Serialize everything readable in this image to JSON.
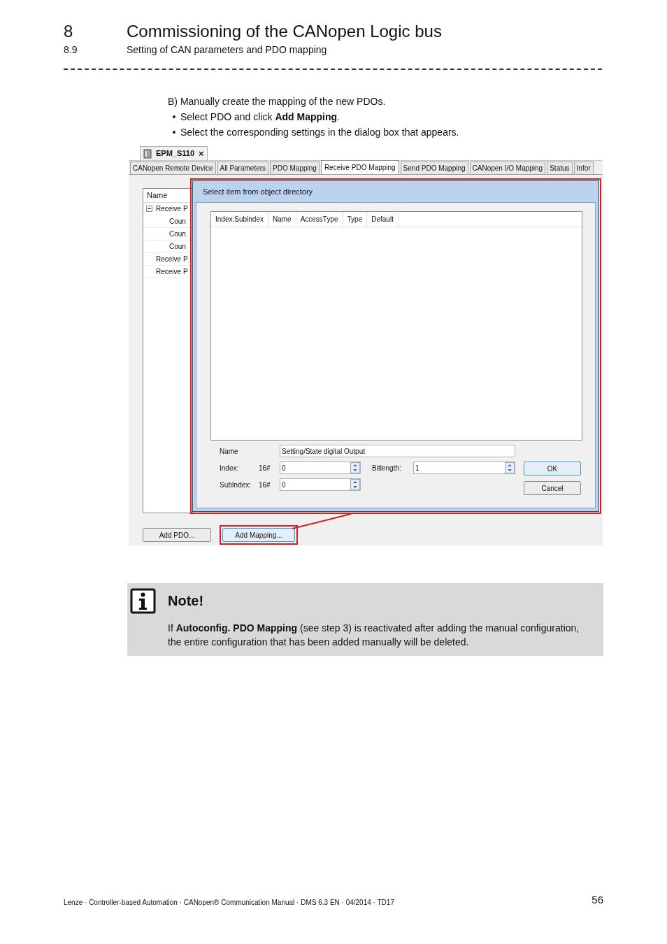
{
  "header": {
    "chapter_number": "8",
    "chapter_title": "Commissioning of the CANopen Logic bus",
    "section_number": "8.9",
    "section_title": "Setting of CAN parameters and PDO mapping"
  },
  "instructions": {
    "heading": "B) Manually create the mapping of the new PDOs.",
    "bullets": [
      {
        "mark": "•",
        "text": "Select PDO and click **Add Mapping**."
      },
      {
        "mark": "•",
        "text": "Select the corresponding settings in the dialog box that appears."
      }
    ]
  },
  "screenshot": {
    "document_tab": {
      "title": "EPM_S110",
      "close": "×"
    },
    "tabs": [
      {
        "label": "CANopen Remote Device",
        "selected": false
      },
      {
        "label": "All Parameters",
        "selected": false
      },
      {
        "label": "PDO Mapping",
        "selected": false
      },
      {
        "label": "Receive PDO Mapping",
        "selected": true
      },
      {
        "label": "Send PDO Mapping",
        "selected": false
      },
      {
        "label": "CANopen I/O Mapping",
        "selected": false
      },
      {
        "label": "Status",
        "selected": false
      },
      {
        "label": "Infor",
        "selected": false
      }
    ],
    "tree": {
      "header": "Name",
      "items": [
        {
          "label": "Receive P",
          "expanded": true,
          "children": [
            {
              "label": "Coun"
            },
            {
              "label": "Coun"
            },
            {
              "label": "Coun"
            }
          ]
        },
        {
          "label": "Receive P"
        },
        {
          "label": "Receive P"
        }
      ]
    },
    "dialog": {
      "title": "Select item from object directory",
      "highlighted": true,
      "columns": [
        "Index:Subindex",
        "Name",
        "AccessType",
        "Type",
        "Default"
      ],
      "name_label": "Name",
      "name_value": "Setting/State digital Output",
      "index_label": "Index:",
      "index_prefix": "16#",
      "index_value": "0",
      "subindex_label": "SubIndex:",
      "subindex_prefix": "16#",
      "subindex_value": "0",
      "bitlength_label": "Bitlength:",
      "bitlength_value": "1",
      "buttons": [
        {
          "label": "OK",
          "default": true
        },
        {
          "label": "Cancel",
          "default": false
        }
      ]
    },
    "bottom_buttons": [
      {
        "label": "Add PDO...",
        "highlighted": false
      },
      {
        "label": "Add Mapping...",
        "highlighted": true
      }
    ]
  },
  "note": {
    "title": "Note!",
    "text": "If **Autoconfig. PDO Mapping** (see step 3) is reactivated after adding the manual configuration, the entire configuration that has been added manually will be deleted."
  },
  "footer": {
    "text": "Lenze · Controller-based Automation · CANopen® Communication Manual · DMS 6.3 EN · 04/2014 · TD17",
    "page": "56"
  }
}
